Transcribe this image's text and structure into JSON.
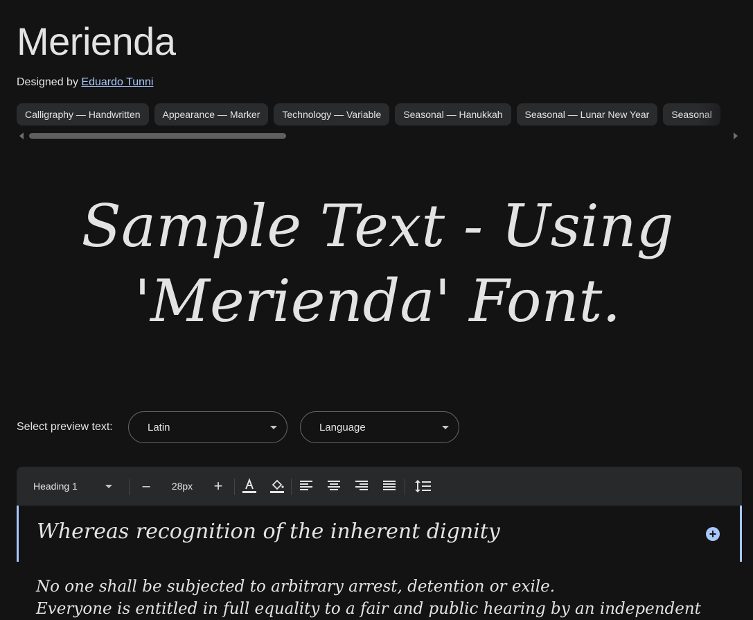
{
  "font": {
    "name": "Merienda",
    "designed_by_label": "Designed by",
    "designer": "Eduardo Tunni"
  },
  "tags": [
    "Calligraphy — Handwritten",
    "Appearance — Marker",
    "Technology — Variable",
    "Seasonal — Hanukkah",
    "Seasonal — Lunar New Year",
    "Seasonal"
  ],
  "sample": {
    "line1": "Sample Text - Using",
    "line2": "'Merienda' Font."
  },
  "preview": {
    "label": "Select preview text:",
    "script_value": "Latin",
    "language_value": "Language"
  },
  "toolbar": {
    "style_value": "Heading 1",
    "decrease_label": "–",
    "size_value": "28px",
    "increase_label": "+"
  },
  "editor": {
    "heading": "Whereas recognition of the inherent dignity",
    "body_line1": "No one shall be subjected to arbitrary arrest, detention or exile.",
    "body_line2": "Everyone is entitled in full equality to a fair and public hearing by an independent"
  },
  "colors": {
    "background": "#131313",
    "accent": "#a8c7fa",
    "chip": "#2a2b2d",
    "toolbar": "#28292a"
  }
}
